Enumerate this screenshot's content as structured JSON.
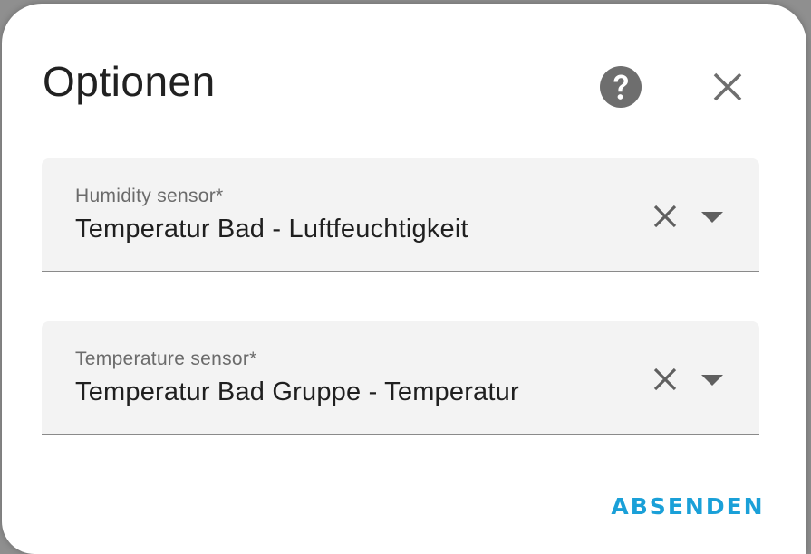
{
  "dialog": {
    "title": "Optionen",
    "help_icon": "help-circle-icon",
    "close_icon": "close-icon"
  },
  "fields": [
    {
      "label": "Humidity sensor*",
      "value": "Temperatur Bad - Luftfeuchtigkeit",
      "clear_icon": "clear-icon",
      "dropdown_icon": "chevron-down-icon"
    },
    {
      "label": "Temperature sensor*",
      "value": "Temperatur Bad Gruppe - Temperatur",
      "clear_icon": "clear-icon",
      "dropdown_icon": "chevron-down-icon"
    }
  ],
  "actions": {
    "submit_label": "ABSENDEN"
  },
  "colors": {
    "accent": "#1aa0d8",
    "field_background": "#f3f3f3",
    "icon": "#6e6e6e"
  }
}
